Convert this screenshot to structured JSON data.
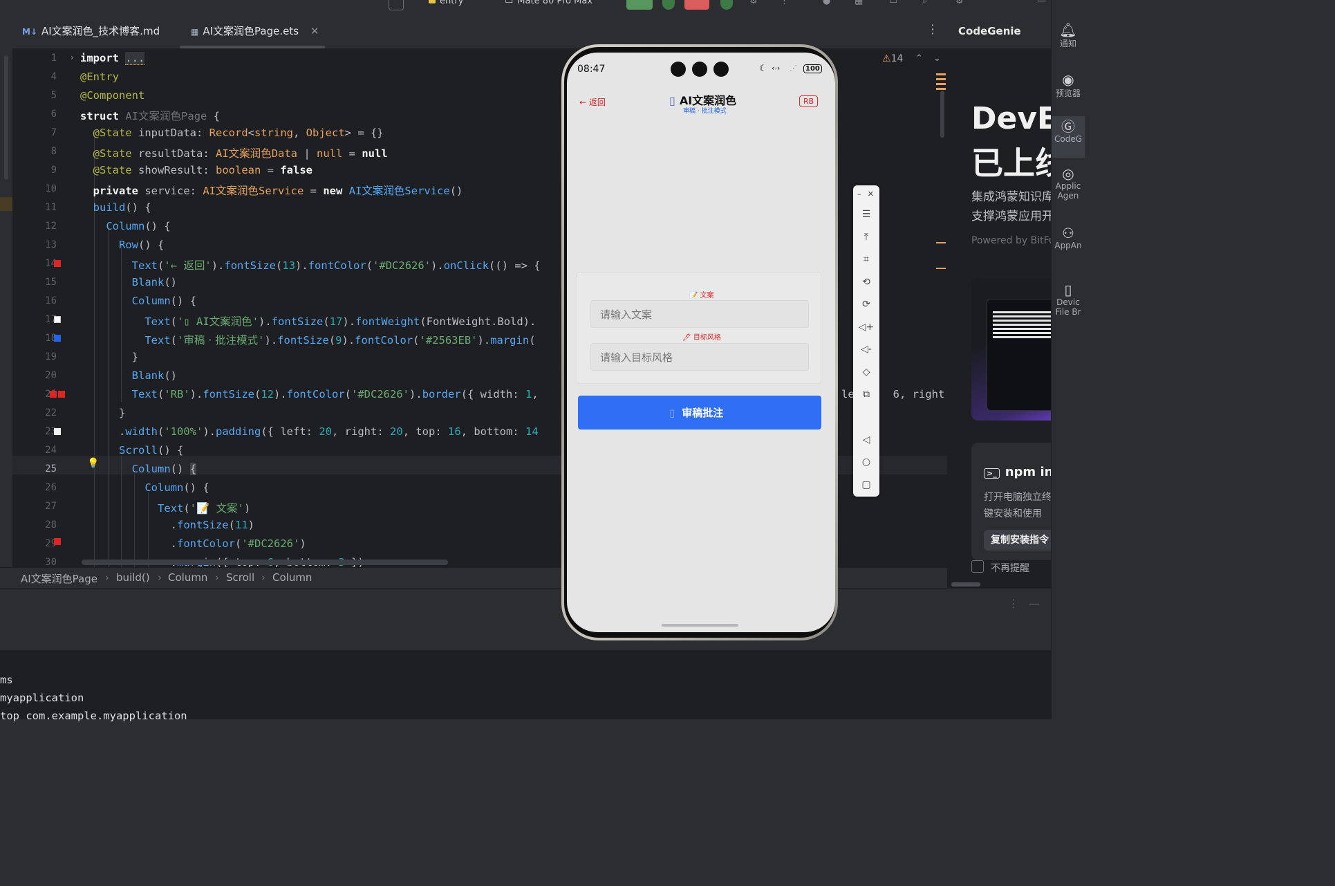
{
  "topbar": {
    "items": [
      "entry",
      "Mate 80 Pro Max"
    ]
  },
  "tabs": [
    {
      "icon": "M↓",
      "label": "AI文案润色_技术博客.md"
    },
    {
      "icon": "▦",
      "label": "AI文案润色Page.ets"
    }
  ],
  "editor": {
    "warnings_count": "14",
    "lines": [
      {
        "n": "1"
      },
      {
        "n": "4"
      },
      {
        "n": "5"
      },
      {
        "n": "6"
      },
      {
        "n": "7"
      },
      {
        "n": "8"
      },
      {
        "n": "9"
      },
      {
        "n": "10"
      },
      {
        "n": "11"
      },
      {
        "n": "12"
      },
      {
        "n": "13"
      },
      {
        "n": "14"
      },
      {
        "n": "15"
      },
      {
        "n": "16"
      },
      {
        "n": "17"
      },
      {
        "n": "18"
      },
      {
        "n": "19"
      },
      {
        "n": "20"
      },
      {
        "n": "21"
      },
      {
        "n": "22"
      },
      {
        "n": "23"
      },
      {
        "n": "24"
      },
      {
        "n": "25"
      },
      {
        "n": "26"
      },
      {
        "n": "27"
      },
      {
        "n": "28"
      },
      {
        "n": "29"
      },
      {
        "n": "30"
      }
    ],
    "right_fragment_line21": "6, right:",
    "right_fragment_line21_prefix": "le"
  },
  "breadcrumb": [
    "AI文案润色Page",
    "build()",
    "Column",
    "Scroll",
    "Column"
  ],
  "console": [
    "ms",
    "myapplication",
    "top com.example.myapplication"
  ],
  "right_panel": {
    "title": "CodeGenie",
    "hero_line1": "DevEc",
    "hero_line2": "已上线",
    "desc1": "集成鸿蒙知识库",
    "desc2": "支撑鸿蒙应用开",
    "powered": "Powered by BitFu",
    "npm_title": "npm ins",
    "npm_desc1": "打开电脑独立终",
    "npm_desc2": "键安装和使用",
    "copy_button": "复制安装指令",
    "dont_remind": "不再提醒"
  },
  "right_strip": [
    "通知",
    "预览器",
    "CodeG",
    "Applic Agen",
    "AppAn",
    "Devic File Br"
  ],
  "phone": {
    "time": "08:47",
    "battery": "100",
    "back": "← 返回",
    "title": "AI文案润色",
    "subtitle": "审稿 · 批注模式",
    "badge": "RB",
    "label_copy": "📝 文案",
    "placeholder_copy": "请输入文案",
    "label_style": "🖊 目标风格",
    "placeholder_style": "请输入目标风格",
    "submit": "审稿批注"
  },
  "colors": {
    "red": "#DC2626",
    "blue": "#2563EB",
    "button": "#2f6ff6"
  }
}
